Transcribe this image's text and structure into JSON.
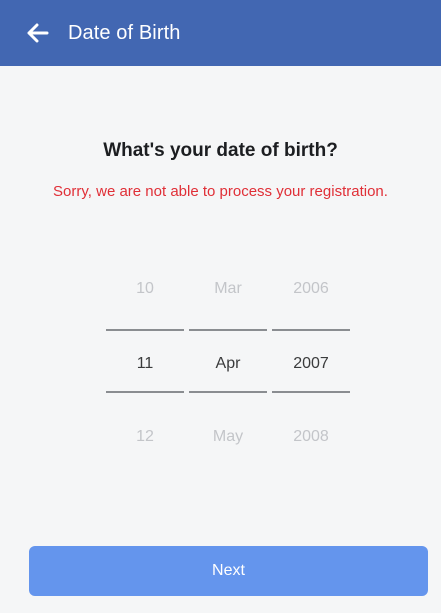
{
  "header": {
    "title": "Date of Birth",
    "back_icon": "arrow-left-icon",
    "background_color": "#4267b2"
  },
  "main": {
    "question": "What's your date of birth?",
    "error_message": "Sorry, we are not able to process your registration.",
    "error_color": "#e02f37"
  },
  "picker": {
    "day": {
      "previous": "10",
      "selected": "11",
      "next": "12"
    },
    "month": {
      "previous": "Mar",
      "selected": "Apr",
      "next": "May"
    },
    "year": {
      "previous": "2006",
      "selected": "2007",
      "next": "2008"
    }
  },
  "footer": {
    "next_label": "Next",
    "button_color": "#6495ed"
  }
}
